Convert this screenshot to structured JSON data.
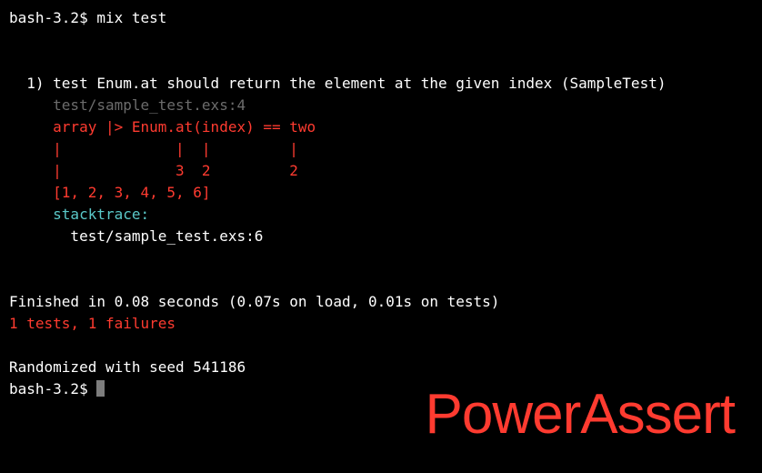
{
  "prompt1": {
    "ps1": "bash-3.2$ ",
    "cmd": "mix test"
  },
  "test": {
    "header": "  1) test Enum.at should return the element at the given index (SampleTest)",
    "location": "     test/sample_test.exs:4",
    "expr": "     array |> Enum.at(index) == two",
    "pipes1": "     |             |  |         |",
    "pipes2": "     |             3  2         2",
    "array": "     [1, 2, 3, 4, 5, 6]",
    "stacktrace_label": "     stacktrace:",
    "stacktrace_line": "       test/sample_test.exs:6"
  },
  "summary": {
    "finished": "Finished in 0.08 seconds (0.07s on load, 0.01s on tests)",
    "results": "1 tests, 1 failures",
    "randomized": "Randomized with seed 541186"
  },
  "prompt2": {
    "ps1": "bash-3.2$ "
  },
  "watermark": "PowerAssert"
}
